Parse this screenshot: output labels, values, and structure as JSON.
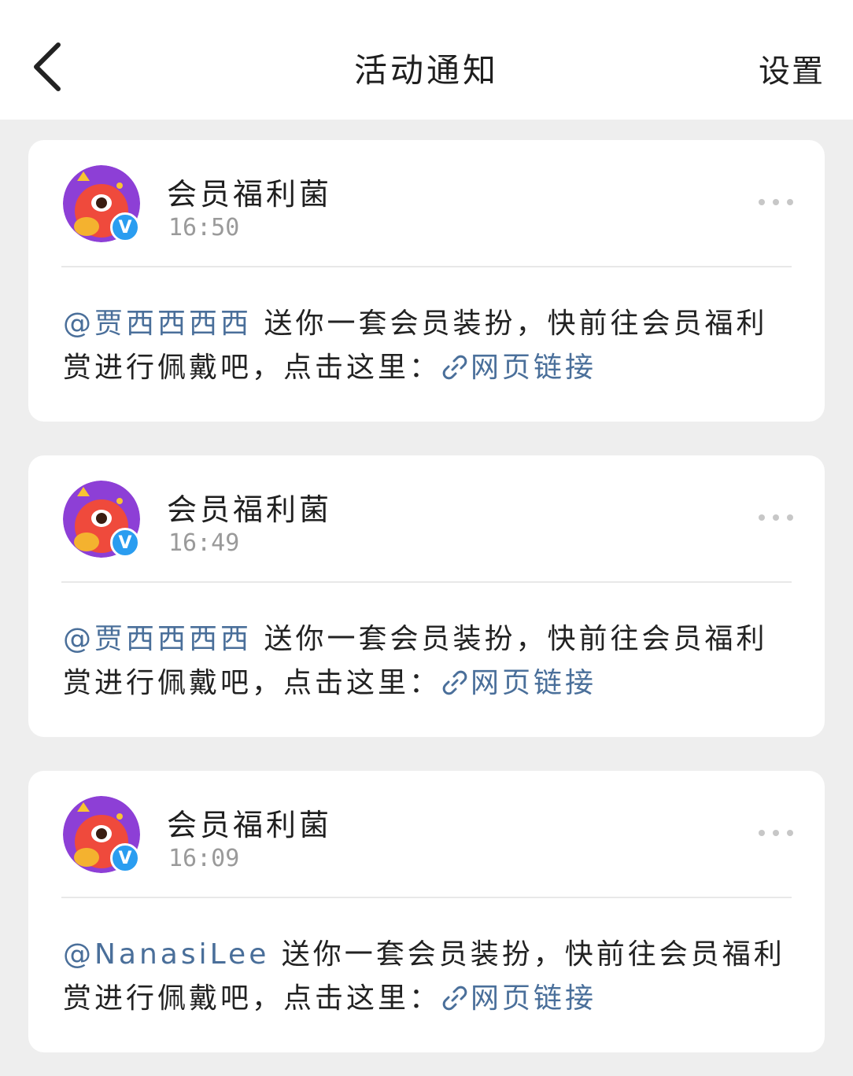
{
  "header": {
    "title": "活动通知",
    "settings_label": "设置",
    "back_icon": "chevron-left-icon"
  },
  "colors": {
    "page_bg": "#eeeeee",
    "card_bg": "#ffffff",
    "link": "#4a6f9a",
    "verified": "#2a9df0",
    "muted": "#9a9a9a"
  },
  "notifications": [
    {
      "sender": "会员福利菌",
      "time": "16:50",
      "mention": "@贾西西西西",
      "message": " 送你一套会员装扮，快前往会员福利赏进行佩戴吧，点击这里：",
      "link_label": "网页链接"
    },
    {
      "sender": "会员福利菌",
      "time": "16:49",
      "mention": "@贾西西西西",
      "message": " 送你一套会员装扮，快前往会员福利赏进行佩戴吧，点击这里：",
      "link_label": "网页链接"
    },
    {
      "sender": "会员福利菌",
      "time": "16:09",
      "mention": "@NanasiLee",
      "message": " 送你一套会员装扮，快前往会员福利赏进行佩戴吧，点击这里：",
      "link_label": "网页链接"
    }
  ]
}
